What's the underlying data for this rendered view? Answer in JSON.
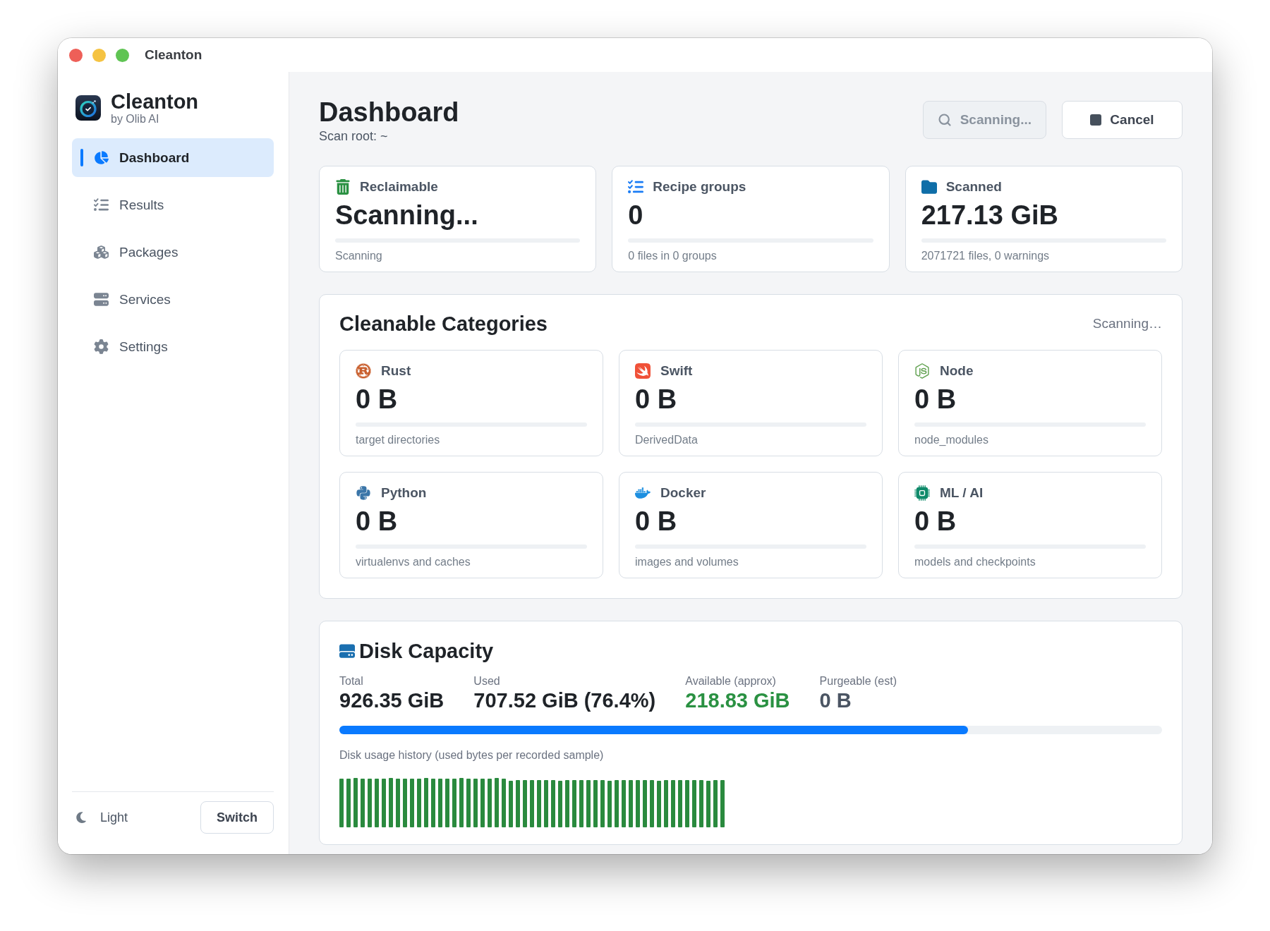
{
  "window": {
    "title": "Cleanton"
  },
  "sidebar": {
    "app_name": "Cleanton",
    "app_subtitle": "by Olib AI",
    "items": [
      {
        "label": "Dashboard",
        "selected": true
      },
      {
        "label": "Results",
        "selected": false
      },
      {
        "label": "Packages",
        "selected": false
      },
      {
        "label": "Services",
        "selected": false
      },
      {
        "label": "Settings",
        "selected": false
      }
    ],
    "theme": {
      "label": "Light",
      "button": "Switch"
    }
  },
  "header": {
    "title": "Dashboard",
    "subtitle": "Scan root: ~",
    "buttons": [
      {
        "label": "Scanning...",
        "disabled": true
      },
      {
        "label": "Cancel",
        "disabled": false
      }
    ]
  },
  "summary_cards": [
    {
      "label": "Reclaimable",
      "value": "Scanning...",
      "caption": "Scanning"
    },
    {
      "label": "Recipe groups",
      "value": "0",
      "caption": "0 files in 0 groups"
    },
    {
      "label": "Scanned",
      "value": "217.13 GiB",
      "caption": "2071721 files, 0 warnings"
    }
  ],
  "categories": {
    "title": "Cleanable Categories",
    "status": "Scanning…",
    "items": [
      {
        "name": "Rust",
        "value": "0 B",
        "caption": "target directories"
      },
      {
        "name": "Swift",
        "value": "0 B",
        "caption": "DerivedData"
      },
      {
        "name": "Node",
        "value": "0 B",
        "caption": "node_modules"
      },
      {
        "name": "Python",
        "value": "0 B",
        "caption": "virtualenvs and caches"
      },
      {
        "name": "Docker",
        "value": "0 B",
        "caption": "images and volumes"
      },
      {
        "name": "ML / AI",
        "value": "0 B",
        "caption": "models and checkpoints"
      }
    ]
  },
  "disk": {
    "title": "Disk Capacity",
    "stats": [
      {
        "label": "Total",
        "value": "926.35 GiB",
        "kind": "plain"
      },
      {
        "label": "Used",
        "value": "707.52 GiB (76.4%)",
        "kind": "plain"
      },
      {
        "label": "Available (approx)",
        "value": "218.83 GiB",
        "kind": "positive"
      },
      {
        "label": "Purgeable (est)",
        "value": "0 B",
        "kind": "muted"
      }
    ],
    "level": 0.764,
    "history_label": "Disk usage history (used bytes per recorded sample)"
  }
}
